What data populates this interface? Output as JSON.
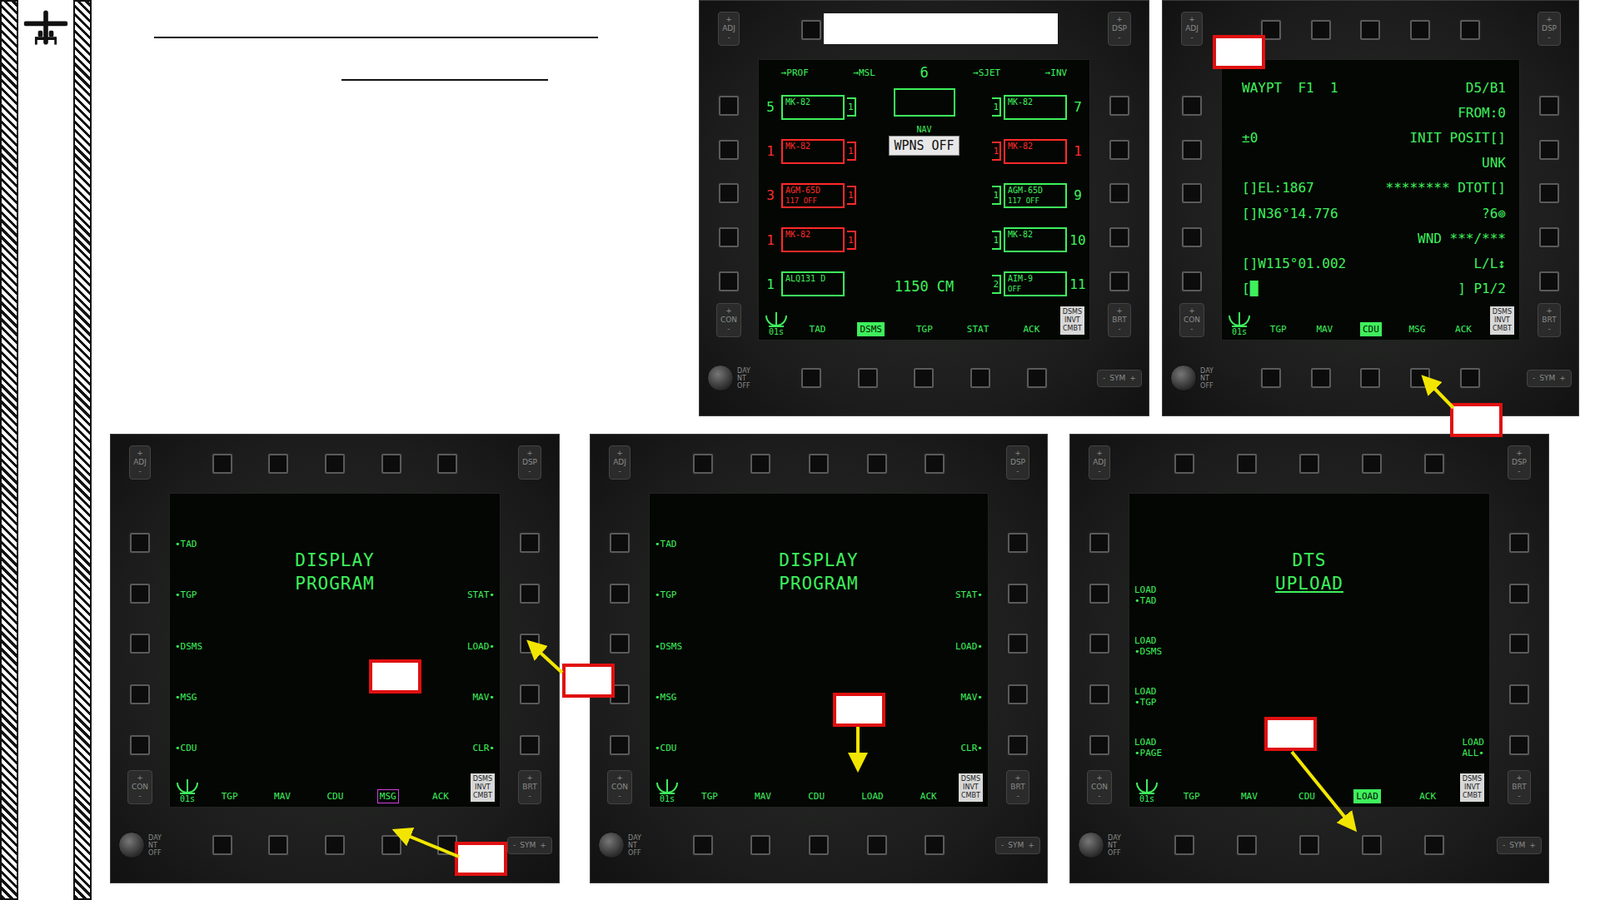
{
  "bezel": {
    "plus": "+",
    "minus": "-",
    "adj": "ADJ",
    "dsp": "DSP",
    "con": "CON",
    "brt": "BRT",
    "sym": "SYM",
    "day": [
      "DAY",
      "NT",
      "OFF"
    ]
  },
  "status_box": [
    "DSMS",
    "INVT",
    "CMBT"
  ],
  "screens": [
    {
      "kind": "dsms",
      "home": "01s",
      "top": [
        "→PROF",
        "→MSL",
        "6",
        "→SJET",
        "→INV"
      ],
      "left": [
        {
          "station": "5",
          "name": "MK-82",
          "sub": "",
          "qty": "1",
          "color": "#3ef05c"
        },
        {
          "station": "1",
          "name": "MK-82",
          "sub": "",
          "qty": "1",
          "color": "#ff2a2a"
        },
        {
          "station": "3",
          "name": "AGM-65D",
          "sub": "117  OFF",
          "qty": "1",
          "color": "#ff2a2a"
        },
        {
          "station": "1",
          "name": "MK-82",
          "sub": "",
          "qty": "1",
          "color": "#ff2a2a"
        },
        {
          "station": "1",
          "name": "ALQ131 D",
          "sub": "",
          "qty": "",
          "color": "#3ef05c"
        }
      ],
      "right": [
        {
          "station": "7",
          "name": "MK-82",
          "sub": "",
          "qty": "1",
          "color": "#3ef05c"
        },
        {
          "station": "1",
          "name": "MK-82",
          "sub": "",
          "qty": "1",
          "color": "#ff2a2a"
        },
        {
          "station": "9",
          "name": "AGM-65D",
          "sub": "117  OFF",
          "qty": "1",
          "color": "#3ef05c"
        },
        {
          "station": "10",
          "name": "MK-82",
          "sub": "",
          "qty": "1",
          "color": "#3ef05c"
        },
        {
          "station": "11",
          "name": "AIM-9",
          "sub": "OFF",
          "qty": "2",
          "color": "#3ef05c"
        }
      ],
      "center": {
        "nav": "NAV",
        "mode": "WPNS OFF",
        "cm": "1150 CM"
      },
      "bottom": [
        {
          "label": "TAD",
          "selected": false,
          "outlined": false
        },
        {
          "label": "DSMS",
          "selected": true,
          "outlined": false
        },
        {
          "label": "TGP",
          "selected": false,
          "outlined": false
        },
        {
          "label": "STAT",
          "selected": false,
          "outlined": false
        },
        {
          "label": "ACK",
          "selected": false,
          "outlined": false
        }
      ]
    },
    {
      "kind": "cdu",
      "home": "01s",
      "top": [],
      "lines": [
        {
          "left": "WAYPT  F1  1",
          "right": "D5/B1"
        },
        {
          "left": "",
          "right": "FROM:0"
        },
        {
          "left": "±0",
          "right": "INIT POSIT[]"
        },
        {
          "left": "",
          "right": "UNK"
        },
        {
          "left": "[]EL:1867",
          "right": "******** DTOT[]"
        },
        {
          "left": "[]N36°14.776",
          "right": "?6⊚"
        },
        {
          "left": "",
          "right": "WND ***/***"
        },
        {
          "left": "[]W115°01.002",
          "right": "L/L↕"
        },
        {
          "left": "[█",
          "right": "] P1/2"
        }
      ],
      "bottom": [
        {
          "label": "TGP",
          "selected": false,
          "outlined": false
        },
        {
          "label": "MAV",
          "selected": false,
          "outlined": false
        },
        {
          "label": "CDU",
          "selected": true,
          "outlined": false
        },
        {
          "label": "MSG",
          "selected": false,
          "outlined": false
        },
        {
          "label": "ACK",
          "selected": false,
          "outlined": false
        }
      ]
    },
    {
      "kind": "menu",
      "home": "01s",
      "top": [],
      "title": [
        {
          "text": "DISPLAY",
          "underlined": false
        },
        {
          "text": "PROGRAM",
          "underlined": false
        }
      ],
      "left": [
        [
          "•TAD"
        ],
        [
          "•TGP"
        ],
        [
          "•DSMS"
        ],
        [
          "•MSG"
        ],
        [
          "•CDU"
        ]
      ],
      "right": [
        [],
        [
          "STAT•"
        ],
        [
          "LOAD•"
        ],
        [
          "MAV•"
        ],
        [
          "CLR•"
        ]
      ],
      "bottom": [
        {
          "label": "TGP",
          "selected": false,
          "outlined": false
        },
        {
          "label": "MAV",
          "selected": false,
          "outlined": false
        },
        {
          "label": "CDU",
          "selected": false,
          "outlined": false
        },
        {
          "label": "MSG",
          "selected": false,
          "outlined": true
        },
        {
          "label": "ACK",
          "selected": false,
          "outlined": false
        }
      ]
    },
    {
      "kind": "menu",
      "home": "01s",
      "top": [],
      "title": [
        {
          "text": "DISPLAY",
          "underlined": false
        },
        {
          "text": "PROGRAM",
          "underlined": false
        }
      ],
      "left": [
        [
          "•TAD"
        ],
        [
          "•TGP"
        ],
        [
          "•DSMS"
        ],
        [
          "•MSG"
        ],
        [
          "•CDU"
        ]
      ],
      "right": [
        [],
        [
          "STAT•"
        ],
        [
          "LOAD•"
        ],
        [
          "MAV•"
        ],
        [
          "CLR•"
        ]
      ],
      "bottom": [
        {
          "label": "TGP",
          "selected": false,
          "outlined": false
        },
        {
          "label": "MAV",
          "selected": false,
          "outlined": false
        },
        {
          "label": "CDU",
          "selected": false,
          "outlined": false
        },
        {
          "label": "LOAD",
          "selected": false,
          "outlined": false
        },
        {
          "label": "ACK",
          "selected": false,
          "outlined": false
        }
      ]
    },
    {
      "kind": "menu",
      "home": "01s",
      "top": [],
      "title": [
        {
          "text": "DTS",
          "underlined": false
        },
        {
          "text": "UPLOAD",
          "underlined": true
        }
      ],
      "left": [
        [],
        [
          "LOAD",
          "•TAD"
        ],
        [
          "LOAD",
          "•DSMS"
        ],
        [
          "LOAD",
          "•TGP"
        ],
        [
          "LOAD",
          "•PAGE"
        ]
      ],
      "right": [
        [],
        [],
        [],
        [],
        [
          "LOAD",
          "ALL•"
        ]
      ],
      "bottom": [
        {
          "label": "TGP",
          "selected": false,
          "outlined": false
        },
        {
          "label": "MAV",
          "selected": false,
          "outlined": false
        },
        {
          "label": "CDU",
          "selected": false,
          "outlined": false
        },
        {
          "label": "LOAD",
          "selected": true,
          "outlined": false
        },
        {
          "label": "ACK",
          "selected": false,
          "outlined": false
        }
      ]
    }
  ]
}
